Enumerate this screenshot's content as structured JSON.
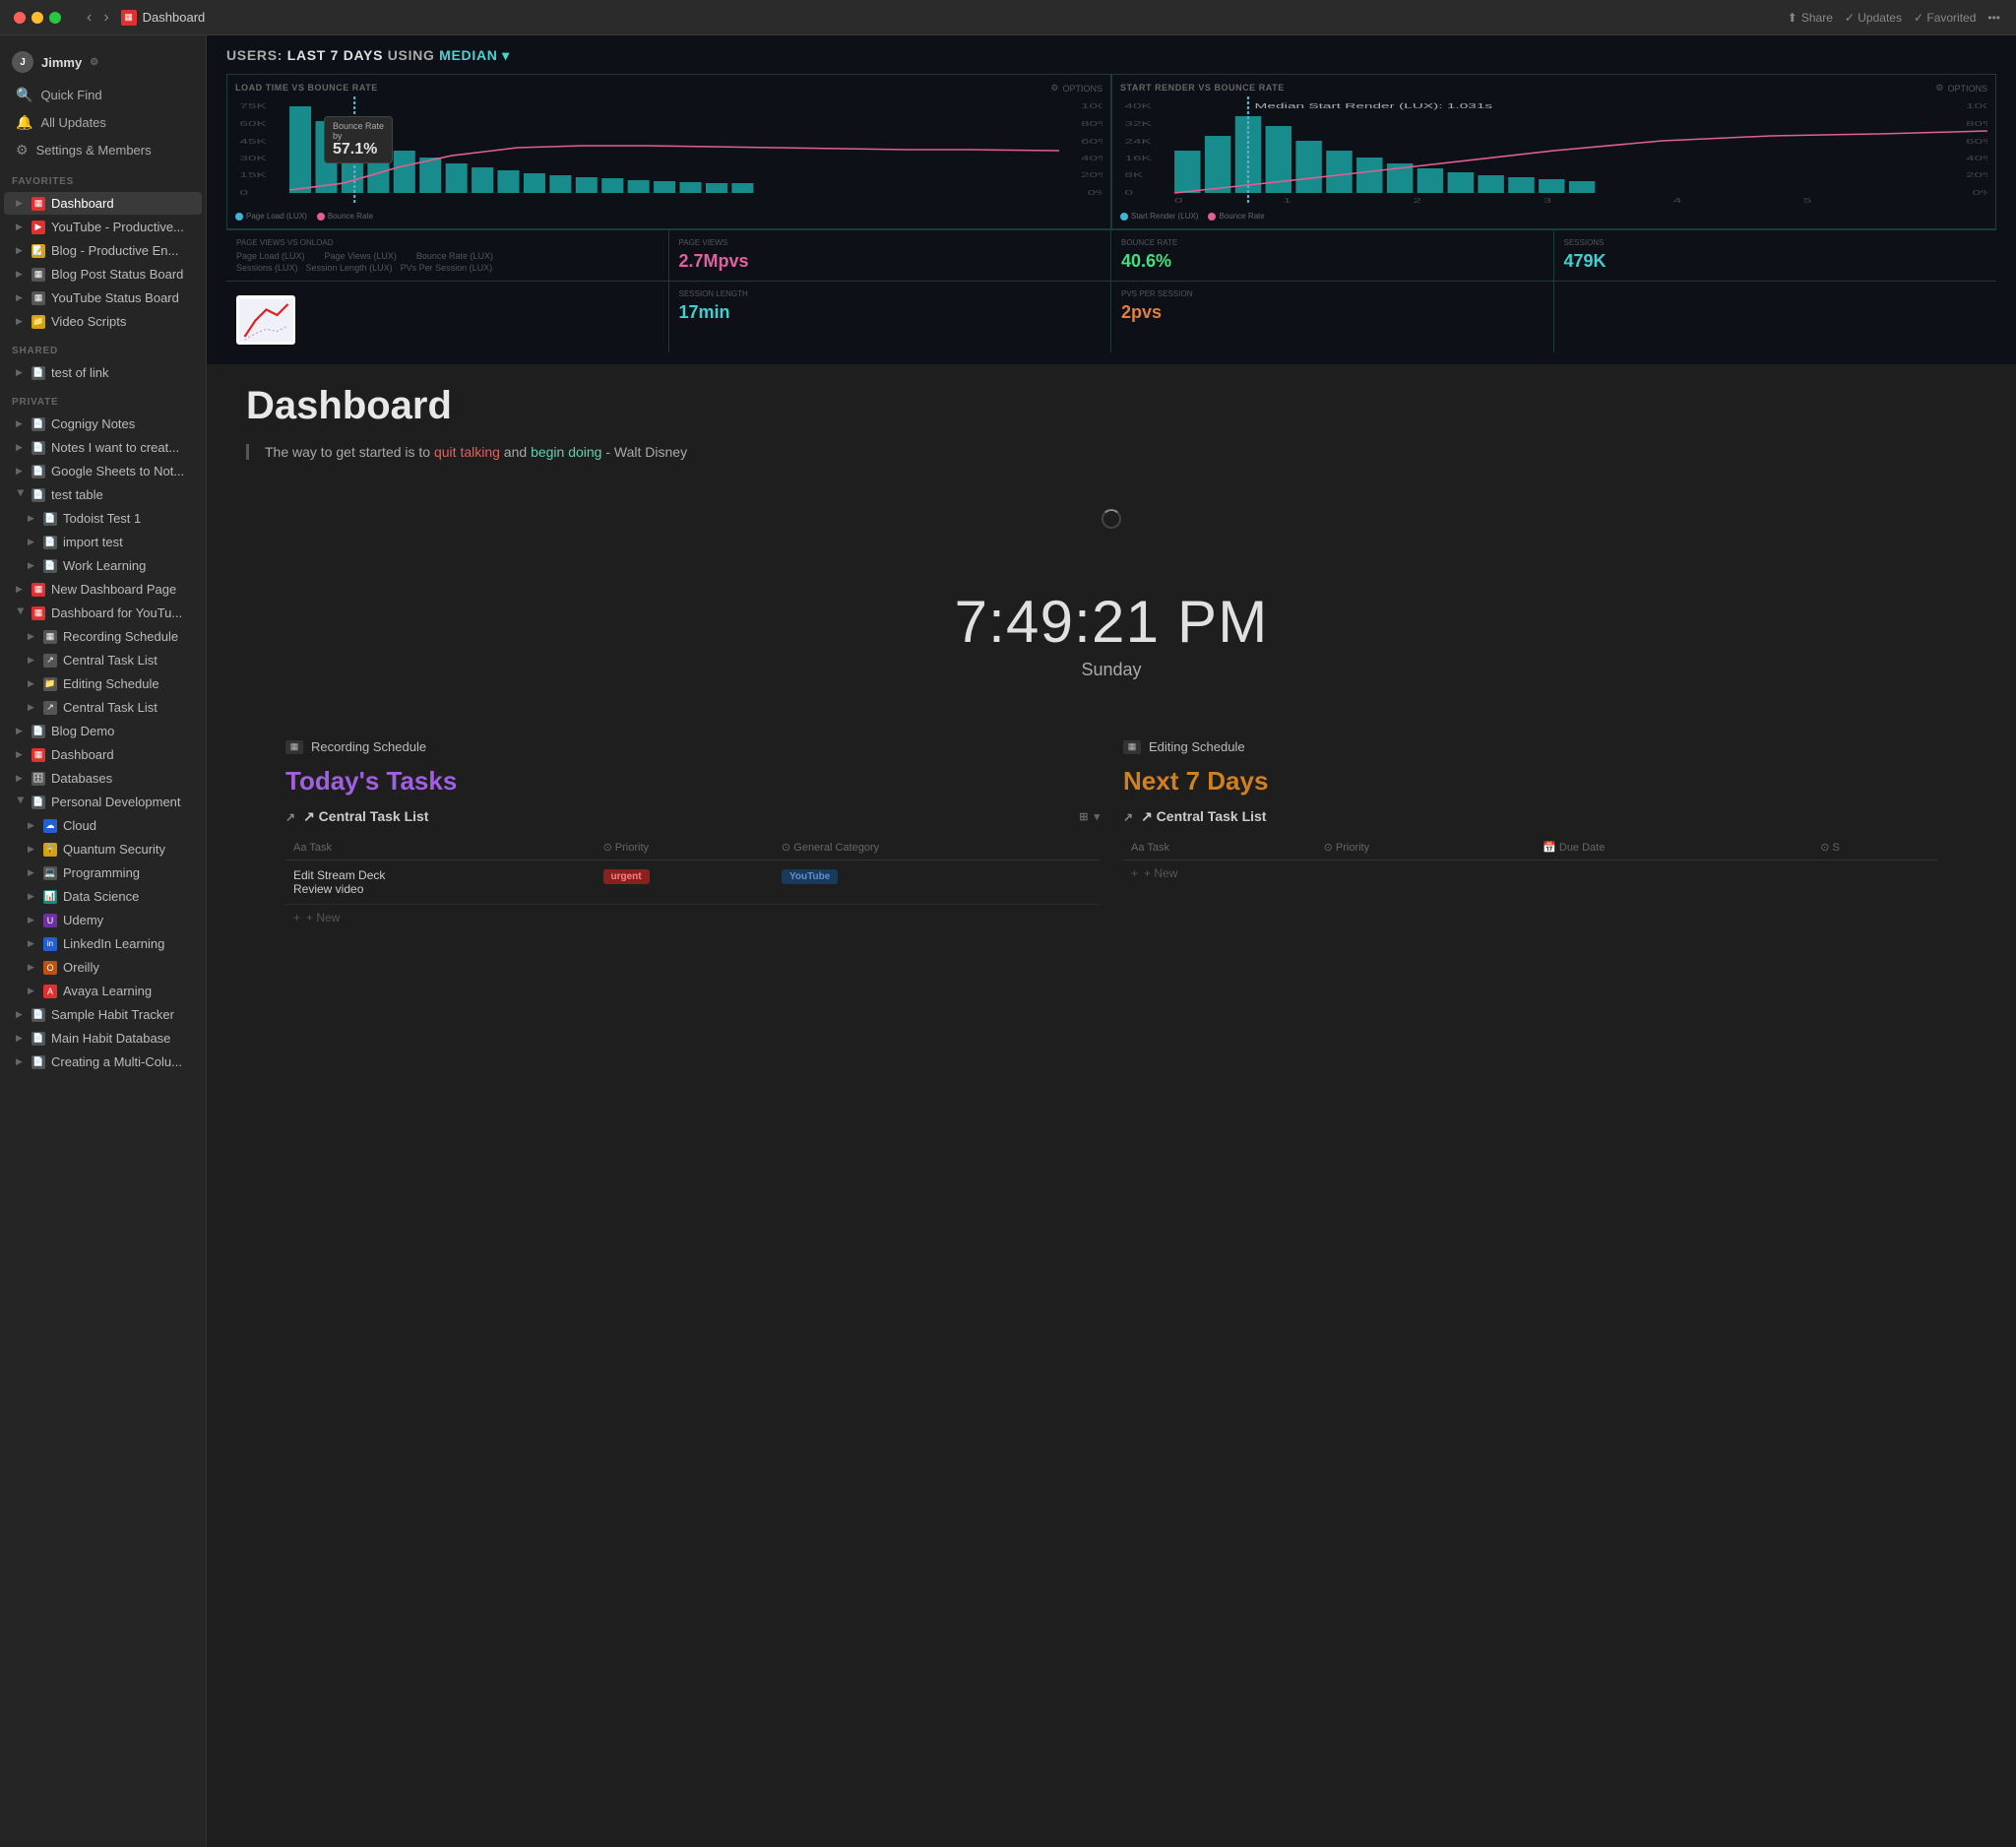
{
  "titlebar": {
    "title": "Dashboard",
    "share_label": "Share",
    "updates_label": "✓ Updates",
    "favorited_label": "✓ Favorited"
  },
  "sidebar": {
    "user": {
      "name": "Jimmy",
      "initial": "J"
    },
    "nav": [
      {
        "id": "quick-find",
        "icon": "🔍",
        "label": "Quick Find"
      },
      {
        "id": "all-updates",
        "icon": "🔔",
        "label": "All Updates"
      },
      {
        "id": "settings",
        "icon": "⚙",
        "label": "Settings & Members"
      }
    ],
    "favorites": {
      "label": "FAVORITES",
      "items": [
        {
          "id": "dashboard",
          "icon": "📊",
          "icon_class": "icon-red",
          "label": "Dashboard",
          "active": true,
          "indent": 0
        },
        {
          "id": "youtube",
          "icon": "▶",
          "icon_class": "icon-red",
          "label": "YouTube - Productive...",
          "indent": 0
        },
        {
          "id": "blog",
          "icon": "📝",
          "icon_class": "icon-yellow",
          "label": "Blog - Productive En...",
          "indent": 0
        },
        {
          "id": "blog-post-status",
          "icon": "📋",
          "icon_class": "icon-gray",
          "label": "Blog Post Status Board",
          "indent": 0
        },
        {
          "id": "youtube-status",
          "icon": "📋",
          "icon_class": "icon-gray",
          "label": "YouTube Status Board",
          "indent": 0
        },
        {
          "id": "video-scripts",
          "icon": "📁",
          "icon_class": "icon-yellow",
          "label": "Video Scripts",
          "indent": 0
        }
      ]
    },
    "shared": {
      "label": "SHARED",
      "items": [
        {
          "id": "test-link",
          "icon": "📄",
          "icon_class": "icon-gray",
          "label": "test of link",
          "indent": 0
        }
      ]
    },
    "private": {
      "label": "PRIVATE",
      "items": [
        {
          "id": "cognigy-notes",
          "icon": "📄",
          "icon_class": "icon-gray",
          "label": "Cognigy Notes",
          "indent": 0
        },
        {
          "id": "notes-i-want",
          "icon": "📄",
          "icon_class": "icon-gray",
          "label": "Notes I want to creat...",
          "indent": 0
        },
        {
          "id": "google-sheets",
          "icon": "📄",
          "icon_class": "icon-gray",
          "label": "Google Sheets to Not...",
          "indent": 0
        },
        {
          "id": "test-table",
          "icon": "📄",
          "icon_class": "icon-gray",
          "label": "test table",
          "indent": 0,
          "expanded": true
        },
        {
          "id": "todoist-test",
          "icon": "📄",
          "icon_class": "icon-gray",
          "label": "Todoist Test 1",
          "indent": 1
        },
        {
          "id": "import-test",
          "icon": "📄",
          "icon_class": "icon-gray",
          "label": "import test",
          "indent": 1
        },
        {
          "id": "work-learning",
          "icon": "📄",
          "icon_class": "icon-gray",
          "label": "Work Learning",
          "indent": 1
        },
        {
          "id": "new-dashboard",
          "icon": "📊",
          "icon_class": "icon-red",
          "label": "New Dashboard Page",
          "indent": 0
        },
        {
          "id": "dashboard-youtube",
          "icon": "📊",
          "icon_class": "icon-red",
          "label": "Dashboard for YouTu...",
          "indent": 0,
          "expanded": true
        },
        {
          "id": "recording-schedule",
          "icon": "📋",
          "icon_class": "icon-gray",
          "label": "Recording Schedule",
          "indent": 1
        },
        {
          "id": "central-task-list-1",
          "icon": "↗",
          "icon_class": "icon-gray",
          "label": "Central Task List",
          "indent": 1
        },
        {
          "id": "editing-schedule",
          "icon": "📁",
          "icon_class": "icon-gray",
          "label": "Editing Schedule",
          "indent": 1
        },
        {
          "id": "central-task-list-2",
          "icon": "↗",
          "icon_class": "icon-gray",
          "label": "Central Task List",
          "indent": 1
        },
        {
          "id": "blog-demo",
          "icon": "📄",
          "icon_class": "icon-gray",
          "label": "Blog Demo",
          "indent": 0
        },
        {
          "id": "dashboard-2",
          "icon": "📊",
          "icon_class": "icon-red",
          "label": "Dashboard",
          "indent": 0,
          "active": false
        },
        {
          "id": "databases",
          "icon": "🗄",
          "icon_class": "icon-gray",
          "label": "Databases",
          "indent": 0
        },
        {
          "id": "personal-dev",
          "icon": "📄",
          "icon_class": "icon-gray",
          "label": "Personal Development",
          "indent": 0,
          "expanded": true
        },
        {
          "id": "cloud",
          "icon": "☁",
          "icon_class": "icon-blue",
          "label": "Cloud",
          "indent": 1
        },
        {
          "id": "quantum-security",
          "icon": "🔒",
          "icon_class": "icon-yellow",
          "label": "Quantum Security",
          "indent": 1
        },
        {
          "id": "programming",
          "icon": "💻",
          "icon_class": "icon-gray",
          "label": "Programming",
          "indent": 1
        },
        {
          "id": "data-science",
          "icon": "📊",
          "icon_class": "icon-teal",
          "label": "Data Science",
          "indent": 1
        },
        {
          "id": "udemy",
          "icon": "U",
          "icon_class": "icon-purple",
          "label": "Udemy",
          "indent": 1
        },
        {
          "id": "linkedin-learning",
          "icon": "in",
          "icon_class": "icon-blue",
          "label": "LinkedIn Learning",
          "indent": 1
        },
        {
          "id": "oreilly",
          "icon": "O",
          "icon_class": "icon-orange",
          "label": "Oreilly",
          "indent": 1
        },
        {
          "id": "avaya-learning",
          "icon": "A",
          "icon_class": "icon-red",
          "label": "Avaya Learning",
          "indent": 1
        },
        {
          "id": "sample-habit",
          "icon": "📄",
          "icon_class": "icon-gray",
          "label": "Sample Habit Tracker",
          "indent": 0
        },
        {
          "id": "main-habit-db",
          "icon": "📄",
          "icon_class": "icon-gray",
          "label": "Main Habit Database",
          "indent": 0
        },
        {
          "id": "creating-multi",
          "icon": "📄",
          "icon_class": "icon-gray",
          "label": "Creating a Multi-Colu...",
          "indent": 0
        }
      ]
    }
  },
  "analytics": {
    "title_prefix": "USERS:",
    "title_period": "LAST 7 DAYS",
    "title_using": "USING",
    "title_metric": "MEDIAN",
    "panels": [
      {
        "title": "LOAD TIME VS BOUNCE RATE",
        "options": "OPTIONS",
        "tooltip": {
          "label": "Bounce Rate",
          "sublabel": "by",
          "value": "57.1%"
        },
        "legend": [
          {
            "color": "#40b4d4",
            "label": "Page Load (LUX)"
          },
          {
            "color": "#e06090",
            "label": "Bounce Rate"
          }
        ]
      },
      {
        "title": "START RENDER VS BOUNCE RATE",
        "options": "OPTIONS",
        "note": "Median Start Render (LUX): 1.031s",
        "legend": [
          {
            "color": "#40b4d4",
            "label": "Start Render (LUX)"
          },
          {
            "color": "#e06090",
            "label": "Bounce Rate"
          }
        ]
      }
    ],
    "metrics": [
      {
        "label": "Page Load (LUX)",
        "value": ""
      },
      {
        "label": "Page Views (LUX)",
        "value": "2.7Mpvs",
        "color": "metric-pink"
      },
      {
        "label": "Bounce Rate (LUX)",
        "value": "40.6%",
        "color": "metric-green"
      },
      {
        "label": "Sessions (LUX)",
        "value": "479K",
        "color": "metric-teal"
      },
      {
        "label": "Session Length (LUX)",
        "value": "17min",
        "color": "metric-teal"
      },
      {
        "label": "PVs Per Session (LUX)",
        "value": "2pvs",
        "color": "metric-orange"
      }
    ]
  },
  "page": {
    "title": "Dashboard",
    "quote": {
      "before": "The way to get started is to ",
      "highlight1": "quit talking",
      "between": " and ",
      "highlight2": "begin doing",
      "after": " - Walt Disney"
    }
  },
  "clock": {
    "time": "7:49:21 PM",
    "day": "Sunday"
  },
  "sections": {
    "left": {
      "db_link": "Recording Schedule",
      "heading": "Today's Tasks",
      "task_list_label": "↗ Central Task List",
      "columns": [
        "Task",
        "Priority",
        "General Category"
      ],
      "tasks": [
        {
          "name": "Edit Stream Deck\nReview video",
          "priority": "urgent",
          "category": "YouTube"
        }
      ],
      "new_label": "+ New"
    },
    "right": {
      "db_link": "Editing Schedule",
      "heading": "Next 7 Days",
      "task_list_label": "↗ Central Task List",
      "columns": [
        "Task",
        "Priority",
        "Due Date",
        "S"
      ],
      "new_label": "+ New"
    }
  }
}
